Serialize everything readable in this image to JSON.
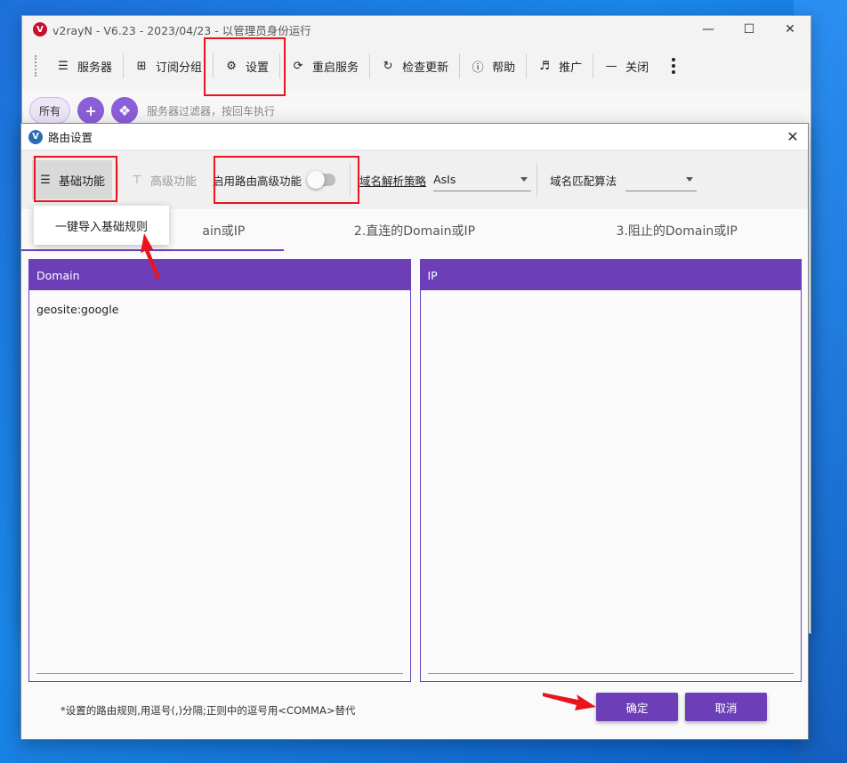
{
  "main_window": {
    "title": "v2rayN - V6.23 - 2023/04/23 - 以管理员身份运行",
    "toolbar": [
      {
        "label": "服务器",
        "icon": "server-icon"
      },
      {
        "label": "订阅分组",
        "icon": "subscription-icon"
      },
      {
        "label": "设置",
        "icon": "gear-icon"
      },
      {
        "label": "重启服务",
        "icon": "restart-icon"
      },
      {
        "label": "检查更新",
        "icon": "update-icon"
      },
      {
        "label": "帮助",
        "icon": "help-icon"
      },
      {
        "label": "推广",
        "icon": "speaker-icon"
      },
      {
        "label": "关闭",
        "icon": "minus-icon"
      }
    ],
    "filter": {
      "all_chip": "所有",
      "placeholder": "服务器过滤器，按回车执行"
    }
  },
  "dialog": {
    "title": "路由设置",
    "basic_button": "基础功能",
    "advanced_button": "高级功能",
    "enable_advanced": "启用路由高级功能",
    "dns_strategy_label": "域名解析策略",
    "dns_strategy_value": "AsIs",
    "domain_match_label": "域名匹配算法",
    "domain_match_value": "",
    "tooltip": "一键导入基础规则",
    "tabs": [
      {
        "label": "ain或IP"
      },
      {
        "label": "2.直连的Domain或IP"
      },
      {
        "label": "3.阻止的Domain或IP"
      }
    ],
    "domain_panel": {
      "header": "Domain",
      "content": "geosite:google"
    },
    "ip_panel": {
      "header": "IP",
      "content": ""
    },
    "hint": "*设置的路由规则,用逗号(,)分隔;正则中的逗号用<COMMA>替代",
    "ok_button": "确定",
    "cancel_button": "取消"
  },
  "colors": {
    "accent": "#6c3fb8",
    "annotation": "#e8141e"
  }
}
